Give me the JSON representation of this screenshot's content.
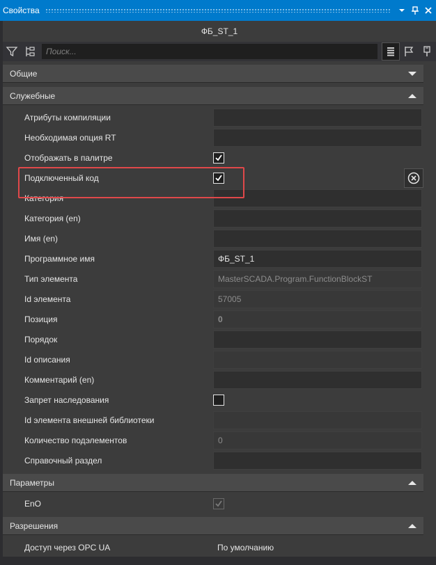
{
  "window": {
    "title": "Свойства",
    "menu_icon": "chevron-down-icon",
    "pin_icon": "pin-icon",
    "close_icon": "close-icon"
  },
  "object_name": "ФБ_ST_1",
  "toolbar": {
    "filter_icon": "filter-icon",
    "sort_icon": "sort-icon",
    "search_placeholder": "Поиск...",
    "list_icon": "list-icon",
    "flag_icon": "flag-icon",
    "marker_icon": "marker-icon"
  },
  "categories": {
    "general": {
      "label": "Общие",
      "expanded": false
    },
    "service": {
      "label": "Служебные",
      "expanded": true
    },
    "parameters": {
      "label": "Параметры",
      "expanded": true
    },
    "permissions": {
      "label": "Разрешения",
      "expanded": true
    }
  },
  "service_props": [
    {
      "label": "Атрибуты компиляции",
      "value": ""
    },
    {
      "label": "Необходимая опция RT",
      "value": ""
    },
    {
      "label": "Отображать в палитре",
      "type": "checkbox",
      "checked": true
    },
    {
      "label": "Подключенный код",
      "type": "checkbox",
      "checked": true
    },
    {
      "label": "Категория",
      "value": ""
    },
    {
      "label": "Категория (en)",
      "value": ""
    },
    {
      "label": "Имя (en)",
      "value": ""
    },
    {
      "label": "Программное имя",
      "value": "ФБ_ST_1"
    },
    {
      "label": "Тип элемента",
      "value": "MasterSCADA.Program.FunctionBlockST",
      "readonly": true
    },
    {
      "label": "Id элемента",
      "value": "57005",
      "readonly": true
    },
    {
      "label": "Позиция",
      "value": "0"
    },
    {
      "label": "Порядок",
      "value": ""
    },
    {
      "label": "Id описания",
      "value": "",
      "readonly": true
    },
    {
      "label": "Комментарий (en)",
      "value": ""
    },
    {
      "label": "Запрет наследования",
      "type": "checkbox",
      "checked": false
    },
    {
      "label": "Id элемента внешней библиотеки",
      "value": "",
      "readonly": true
    },
    {
      "label": "Количество подэлементов",
      "value": "0",
      "readonly": true
    },
    {
      "label": "Справочный раздел",
      "value": ""
    }
  ],
  "parameters_props": [
    {
      "label": "EnO",
      "type": "checkbox",
      "checked": true,
      "disabled": true
    }
  ],
  "permissions_props": [
    {
      "label": "Доступ через OPC UA",
      "value": "По умолчанию"
    }
  ],
  "colors": {
    "titlebar": "#007acc",
    "highlight": "#e0484a"
  }
}
